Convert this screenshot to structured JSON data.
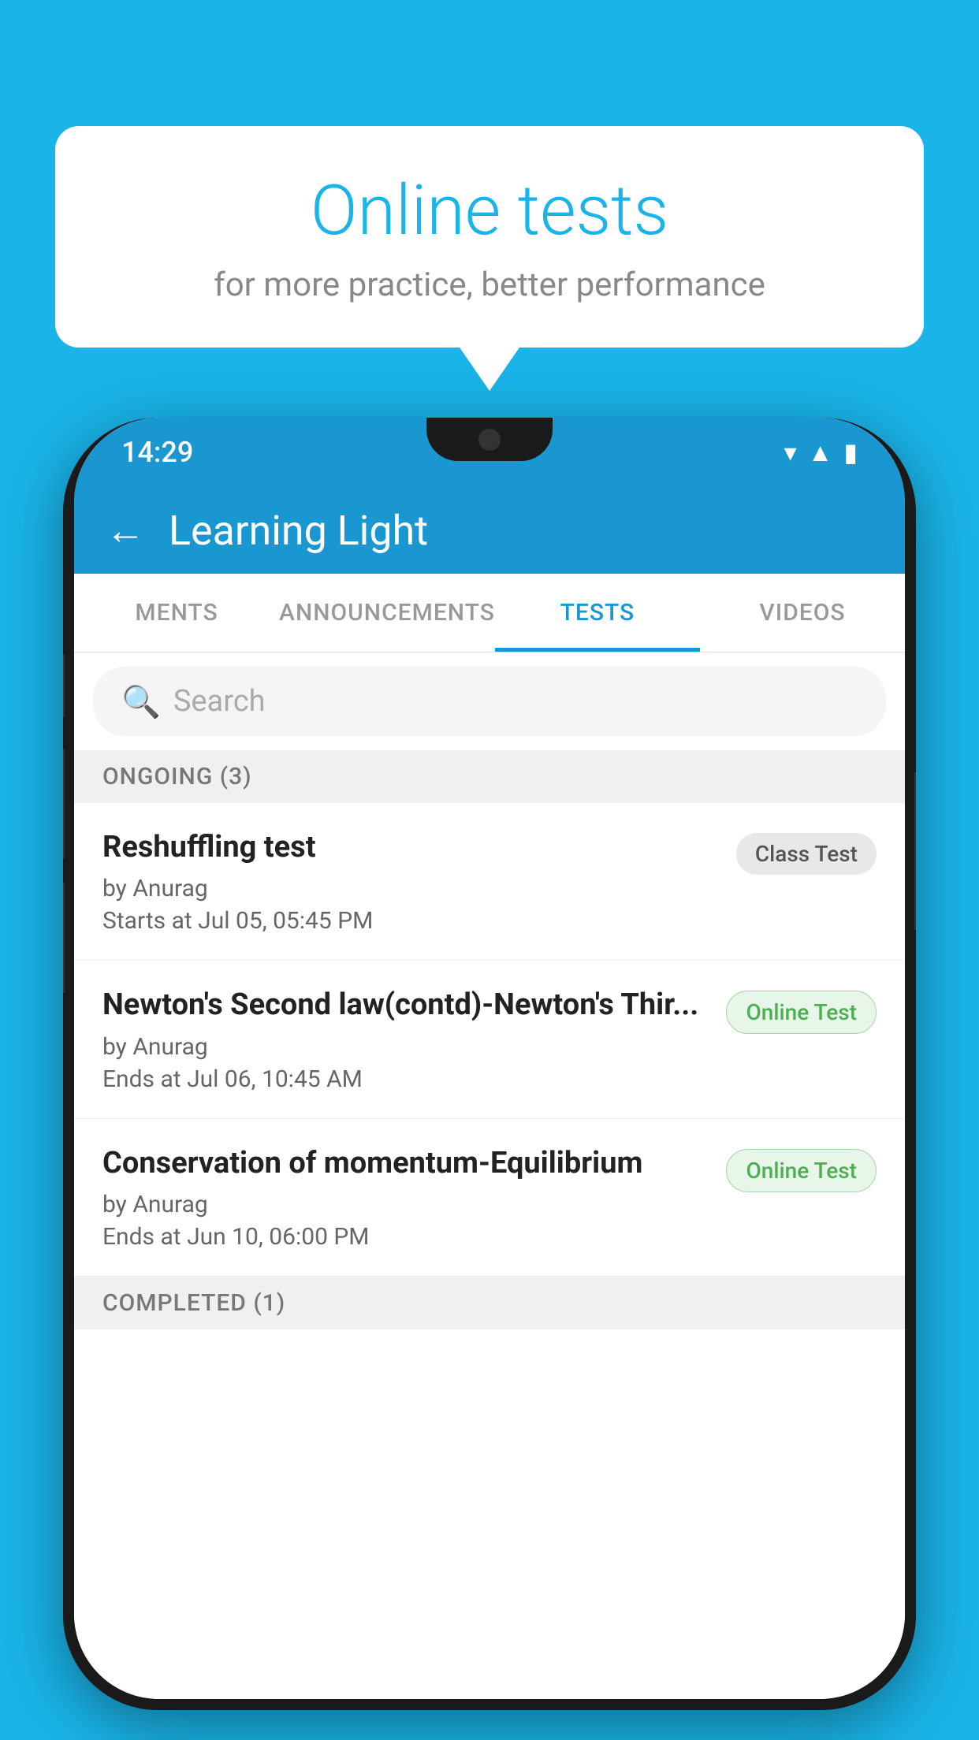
{
  "background_color": "#1ab4e8",
  "speech_bubble": {
    "title": "Online tests",
    "subtitle": "for more practice, better performance"
  },
  "phone": {
    "status_bar": {
      "time": "14:29",
      "icons": [
        "wifi",
        "signal",
        "battery"
      ]
    },
    "app_header": {
      "back_label": "←",
      "title": "Learning Light"
    },
    "tabs": [
      {
        "label": "MENTS",
        "active": false
      },
      {
        "label": "ANNOUNCEMENTS",
        "active": false
      },
      {
        "label": "TESTS",
        "active": true
      },
      {
        "label": "VIDEOS",
        "active": false
      }
    ],
    "search": {
      "placeholder": "Search"
    },
    "ongoing_section": {
      "label": "ONGOING (3)"
    },
    "tests": [
      {
        "name": "Reshuffling test",
        "author": "by Anurag",
        "time_label": "Starts at",
        "time": "Jul 05, 05:45 PM",
        "badge": "Class Test",
        "badge_type": "class"
      },
      {
        "name": "Newton's Second law(contd)-Newton's Thir...",
        "author": "by Anurag",
        "time_label": "Ends at",
        "time": "Jul 06, 10:45 AM",
        "badge": "Online Test",
        "badge_type": "online"
      },
      {
        "name": "Conservation of momentum-Equilibrium",
        "author": "by Anurag",
        "time_label": "Ends at",
        "time": "Jun 10, 06:00 PM",
        "badge": "Online Test",
        "badge_type": "online"
      }
    ],
    "completed_section": {
      "label": "COMPLETED (1)"
    }
  }
}
